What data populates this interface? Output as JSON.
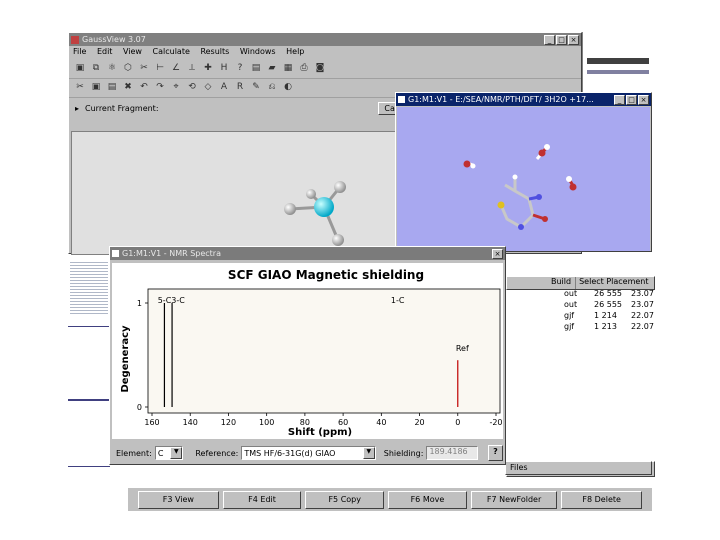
{
  "main_window": {
    "title": "GaussView 3.07",
    "menu": [
      "File",
      "Edit",
      "View",
      "Calculate",
      "Results",
      "Windows",
      "Help"
    ],
    "fragment_label": "Current Fragment:",
    "fragment_value": "Carbon Tetrahedral"
  },
  "molecule_window": {
    "title": "G1:M1:V1 - E:/SEA/NMR/PTH/DFT/ 3H2O  +17..."
  },
  "nmr_window": {
    "title": "G1:M1:V1 - NMR Spectra",
    "controls": {
      "element_label": "Element:",
      "element_value": "C",
      "reference_label": "Reference:",
      "reference_value": "TMS HF/6-31G(d) GIAO",
      "shielding_label": "Shielding:",
      "shielding_value": "189.4186"
    }
  },
  "chart_data": {
    "type": "bar",
    "title": "SCF GIAO Magnetic shielding",
    "xlabel": "Shift (ppm)",
    "ylabel": "Degeneracy",
    "xlim": [
      160,
      -20
    ],
    "ylim": [
      0,
      1
    ],
    "xticks": [
      160,
      140,
      120,
      100,
      80,
      60,
      40,
      20,
      0,
      -20
    ],
    "xtick_labels": [
      "160",
      "140",
      "120",
      "100",
      "80",
      "60",
      "40",
      "20",
      "0",
      "-20"
    ],
    "yticks": [
      0,
      1
    ],
    "ytick_labels": [
      "0",
      "1"
    ],
    "peaks": [
      {
        "shift": 153.5,
        "degeneracy": 1,
        "color": "#000000"
      },
      {
        "shift": 149.5,
        "degeneracy": 1,
        "color": "#000000"
      },
      {
        "shift": 0,
        "degeneracy": 0.45,
        "color": "#c00000"
      }
    ],
    "annotations": [
      {
        "text": "5-C3-C",
        "shift": 157
      },
      {
        "text": "1-C",
        "shift": 35
      },
      {
        "text": "Ref",
        "shift": 1
      }
    ]
  },
  "builder": {
    "build_label": "Build",
    "select_label": "Select Placement",
    "rows": [
      {
        "c1": "out",
        "c2": "26 555",
        "c3": "23.07"
      },
      {
        "c1": "out",
        "c2": "26 555",
        "c3": "23.07"
      },
      {
        "c1": "gjf",
        "c2": "1 214",
        "c3": "22.07"
      },
      {
        "c1": "gjf",
        "c2": "1 213",
        "c3": "22.07"
      }
    ]
  },
  "file_manager": {
    "files_label": "Files",
    "fkeys": [
      "F3 View",
      "F4 Edit",
      "F5 Copy",
      "F6 Move",
      "F7 NewFolder",
      "F8 Delete"
    ]
  }
}
